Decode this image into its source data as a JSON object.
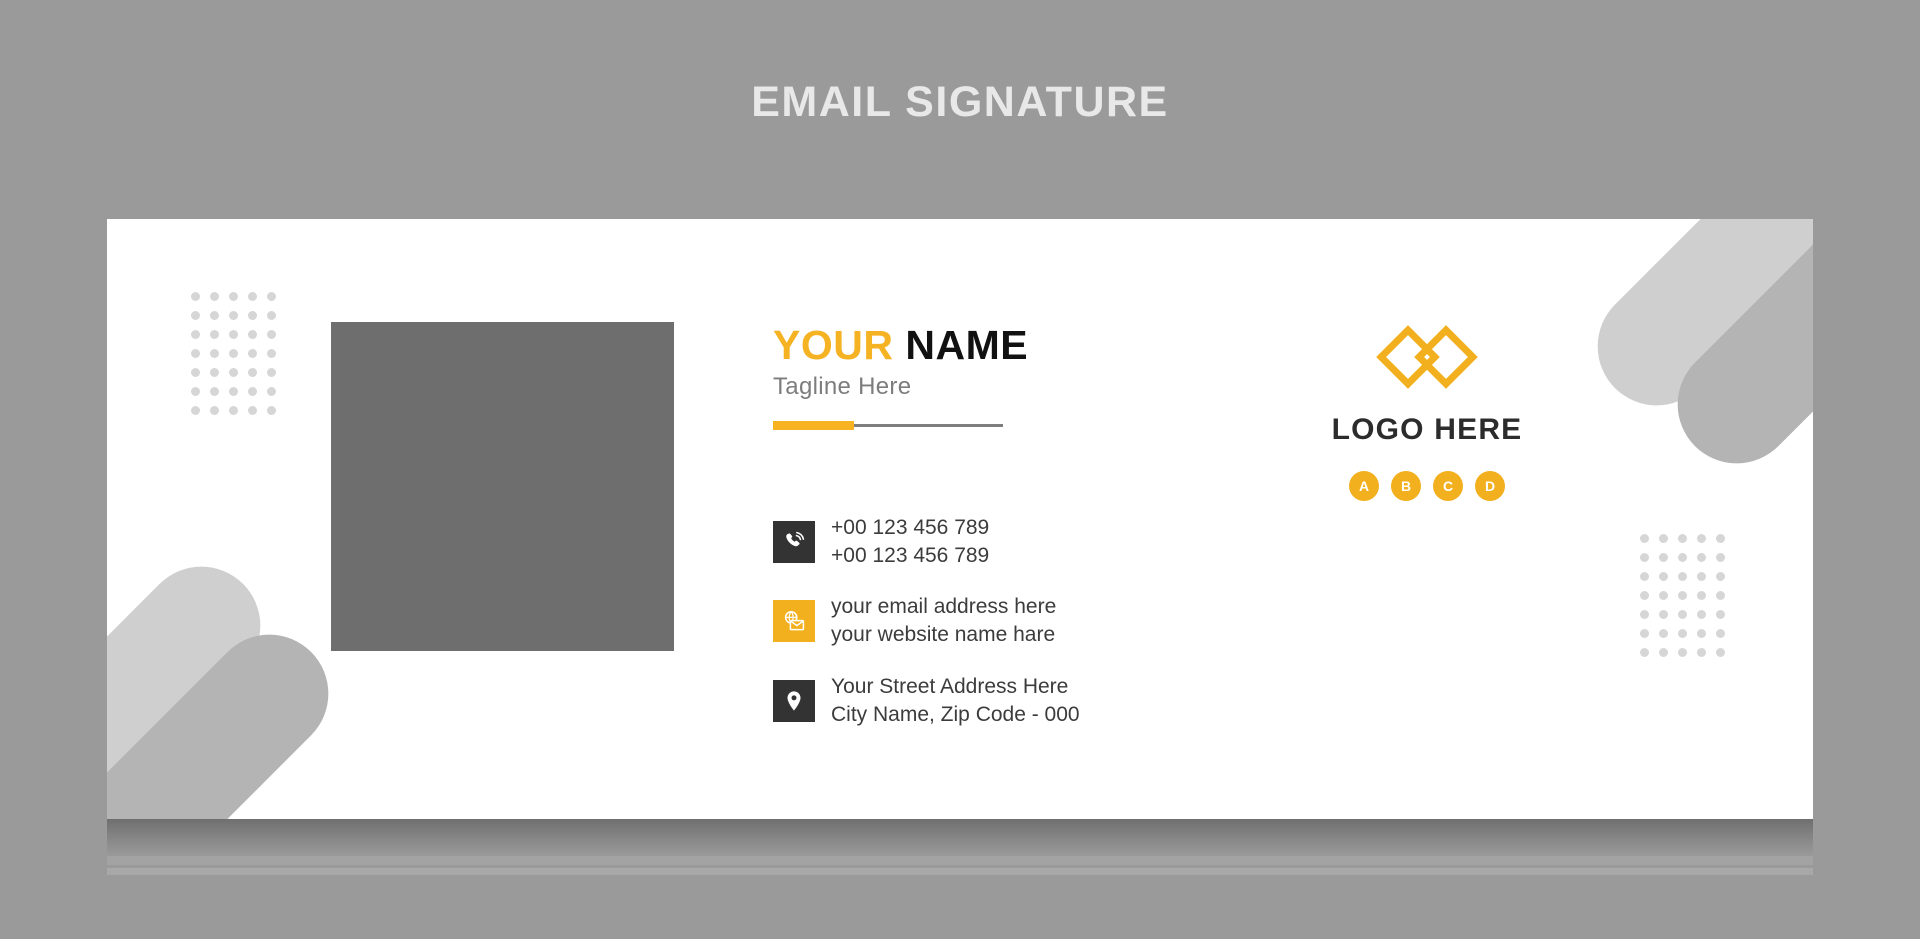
{
  "page": {
    "title": "EMAIL SIGNATURE",
    "background_color": "#9a9a9a"
  },
  "colors": {
    "accent": "#f2b01e",
    "dark": "#333333",
    "text": "#3c3c3c",
    "muted": "#7d7d7d",
    "card_background": "#ffffff",
    "photo_placeholder": "#6e6e6e",
    "dot": "#d6d6d6",
    "capsule_light": "#cfcfcf",
    "capsule_dark": "#b4b4b4"
  },
  "card": {
    "photo_placeholder_name": "profile-photo-placeholder",
    "identity": {
      "first_name": "YOUR",
      "last_name": "NAME",
      "tagline": "Tagline Here"
    },
    "contacts": [
      {
        "icon": "phone-icon",
        "icon_style": "dark",
        "lines": [
          "+00 123 456 789",
          "+00 123 456 789"
        ]
      },
      {
        "icon": "email-globe-icon",
        "icon_style": "amber",
        "lines": [
          "your email address here",
          "your website name hare"
        ]
      },
      {
        "icon": "location-pin-icon",
        "icon_style": "dark",
        "lines": [
          "Your Street Address Here",
          "City Name, Zip Code - 000"
        ]
      }
    ],
    "logo": {
      "mark_name": "interlocking-diamonds-logo",
      "text": "LOGO HERE"
    },
    "social_badges": [
      {
        "label": "A"
      },
      {
        "label": "B"
      },
      {
        "label": "C"
      },
      {
        "label": "D"
      }
    ],
    "decorations": {
      "dot_grid_columns": 5,
      "dot_grid_rows": 7
    }
  }
}
